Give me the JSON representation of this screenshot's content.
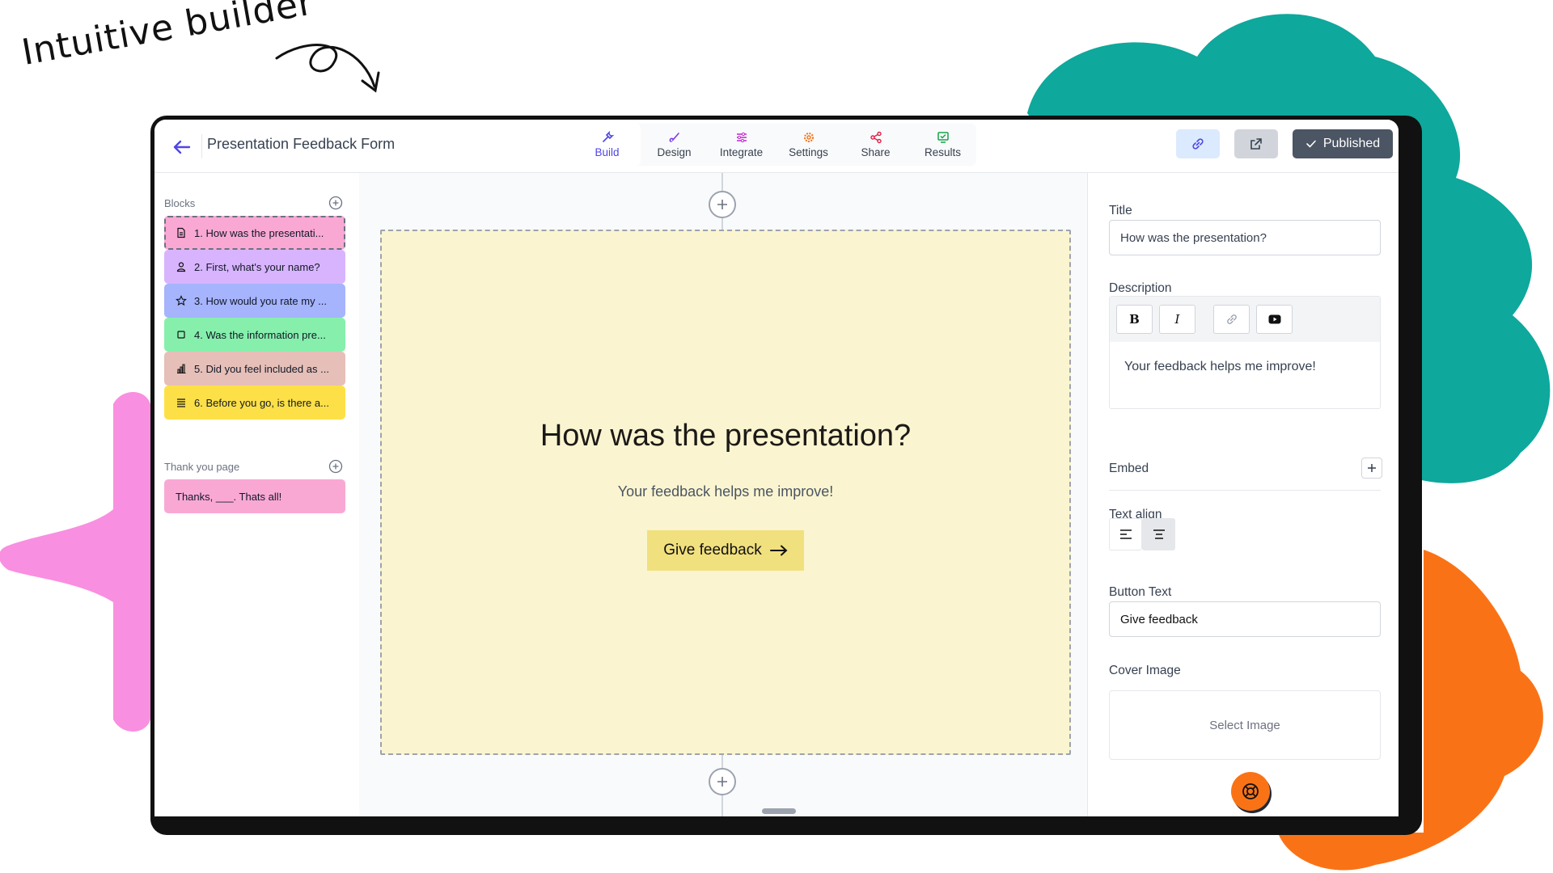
{
  "tagline": "Intuitive builder",
  "colors": {
    "teal": "#0ea89c",
    "orange": "#f97316",
    "pink": "#f98fe0",
    "accent": "#4f46e5",
    "card_bg": "#faf5d0",
    "card_button": "#f1e07e"
  },
  "header": {
    "form_title": "Presentation Feedback Form",
    "tabs": [
      {
        "label": "Build",
        "icon": "wrench-icon"
      },
      {
        "label": "Design",
        "icon": "brush-icon"
      },
      {
        "label": "Integrate",
        "icon": "sliders-icon"
      },
      {
        "label": "Settings",
        "icon": "gear-icon"
      },
      {
        "label": "Share",
        "icon": "share-icon"
      },
      {
        "label": "Results",
        "icon": "results-icon"
      }
    ],
    "active_tab": "Build",
    "published_label": "Published"
  },
  "sidebar": {
    "blocks_label": "Blocks",
    "blocks": [
      {
        "label": "1. How was the presentati...",
        "icon": "document-icon",
        "color": "#f9a8d4"
      },
      {
        "label": "2. First, what's your name?",
        "icon": "user-icon",
        "color": "#d8b4fe"
      },
      {
        "label": "3. How would you rate my ...",
        "icon": "star-icon",
        "color": "#a5b4fc"
      },
      {
        "label": "4. Was the information pre...",
        "icon": "checkbox-icon",
        "color": "#86efac"
      },
      {
        "label": "5. Did you feel included as ...",
        "icon": "bar-chart-icon",
        "color": "#e6bfb8"
      },
      {
        "label": "6. Before you go, is there a...",
        "icon": "text-lines-icon",
        "color": "#fde047"
      }
    ],
    "thankyou_label": "Thank you page",
    "thankyou_block": {
      "label": "Thanks, ___. Thats all!",
      "color": "#f9a8d4"
    }
  },
  "canvas": {
    "question_title": "How was the presentation?",
    "question_description": "Your feedback helps me improve!",
    "button_text": "Give feedback"
  },
  "panel": {
    "title_label": "Title",
    "title_value": "How was the presentation?",
    "description_label": "Description",
    "editor_buttons": [
      "B",
      "I"
    ],
    "description_value": "Your feedback helps me improve!",
    "embed_label": "Embed",
    "text_align_label": "Text align",
    "text_align_selected": "center",
    "button_text_label": "Button Text",
    "button_text_value": "Give feedback",
    "cover_image_label": "Cover Image",
    "select_image_label": "Select Image"
  }
}
